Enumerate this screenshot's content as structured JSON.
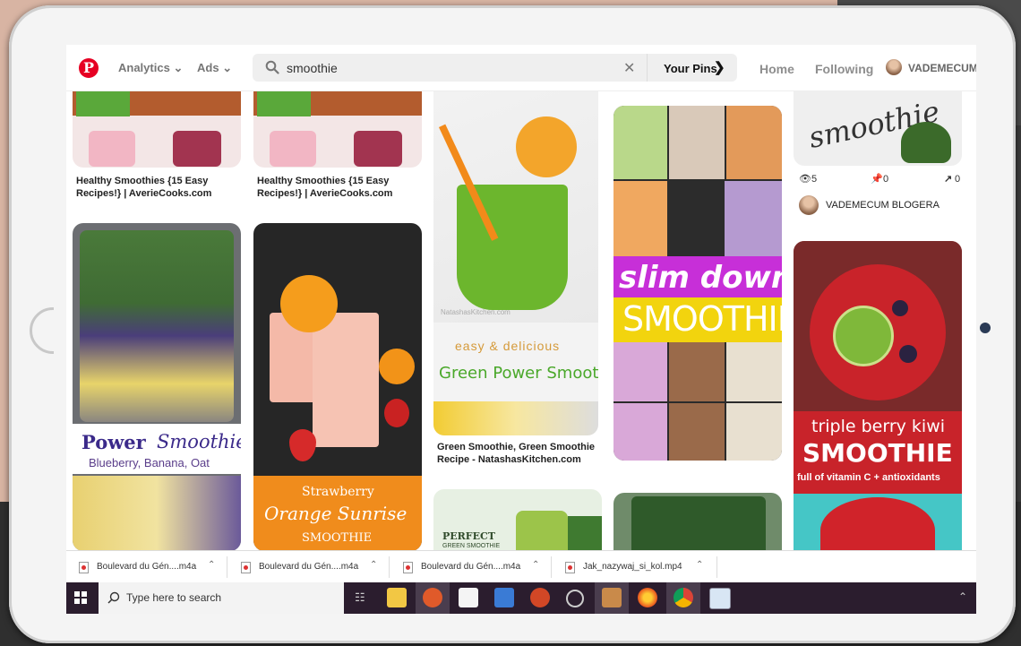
{
  "header": {
    "logo": "P",
    "analytics": "Analytics",
    "ads": "Ads",
    "search_value": "smoothie",
    "your_pins": "Your Pins",
    "home": "Home",
    "following": "Following",
    "username": "VADEMECUM ."
  },
  "pins": {
    "p1_caption": "Healthy Smoothies {15 Easy Recipes!} | AverieCooks.com",
    "p2_caption": "Healthy Smoothies {15 Easy Recipes!} | AverieCooks.com",
    "p4_text1": "Power",
    "p4_text2": "Smoothie",
    "p4_text3": "Blueberry, Banana, Oat",
    "p5_text1": "Strawberry",
    "p5_text2": "Orange Sunrise",
    "p5_text3": "SMOOTHIE",
    "p6_watermark": "NatashasKitchen.com",
    "p6_text1": "easy & delicious",
    "p6_text2": "Green Power Smoothie",
    "p6_caption": "Green Smoothie, Green Smoothie Recipe - NatashasKitchen.com",
    "p7_text1": "PERFECT",
    "p7_text2": "GREEN SMOOTHIE",
    "p8_text1": "slim down",
    "p8_text2": "SMOOTHIES",
    "p10_text": "smoothie",
    "p10_views": "5",
    "p10_saves": "0",
    "p10_shares": "0",
    "p10_author": "VADEMECUM BLOGERA",
    "p11_text1": "triple berry kiwi",
    "p11_text2": "SMOOTHIE",
    "p11_text3": "full of vitamin C + antioxidants"
  },
  "downloads": [
    {
      "name": "Boulevard du Gén....m4a"
    },
    {
      "name": "Boulevard du Gén....m4a"
    },
    {
      "name": "Boulevard du Gén....m4a"
    },
    {
      "name": "Jak_nazywaj_si_kol.mp4"
    }
  ],
  "taskbar": {
    "search_placeholder": "Type here to search"
  },
  "colors": {
    "brand": "#e60023",
    "taskbar": "#2b1d2e"
  }
}
